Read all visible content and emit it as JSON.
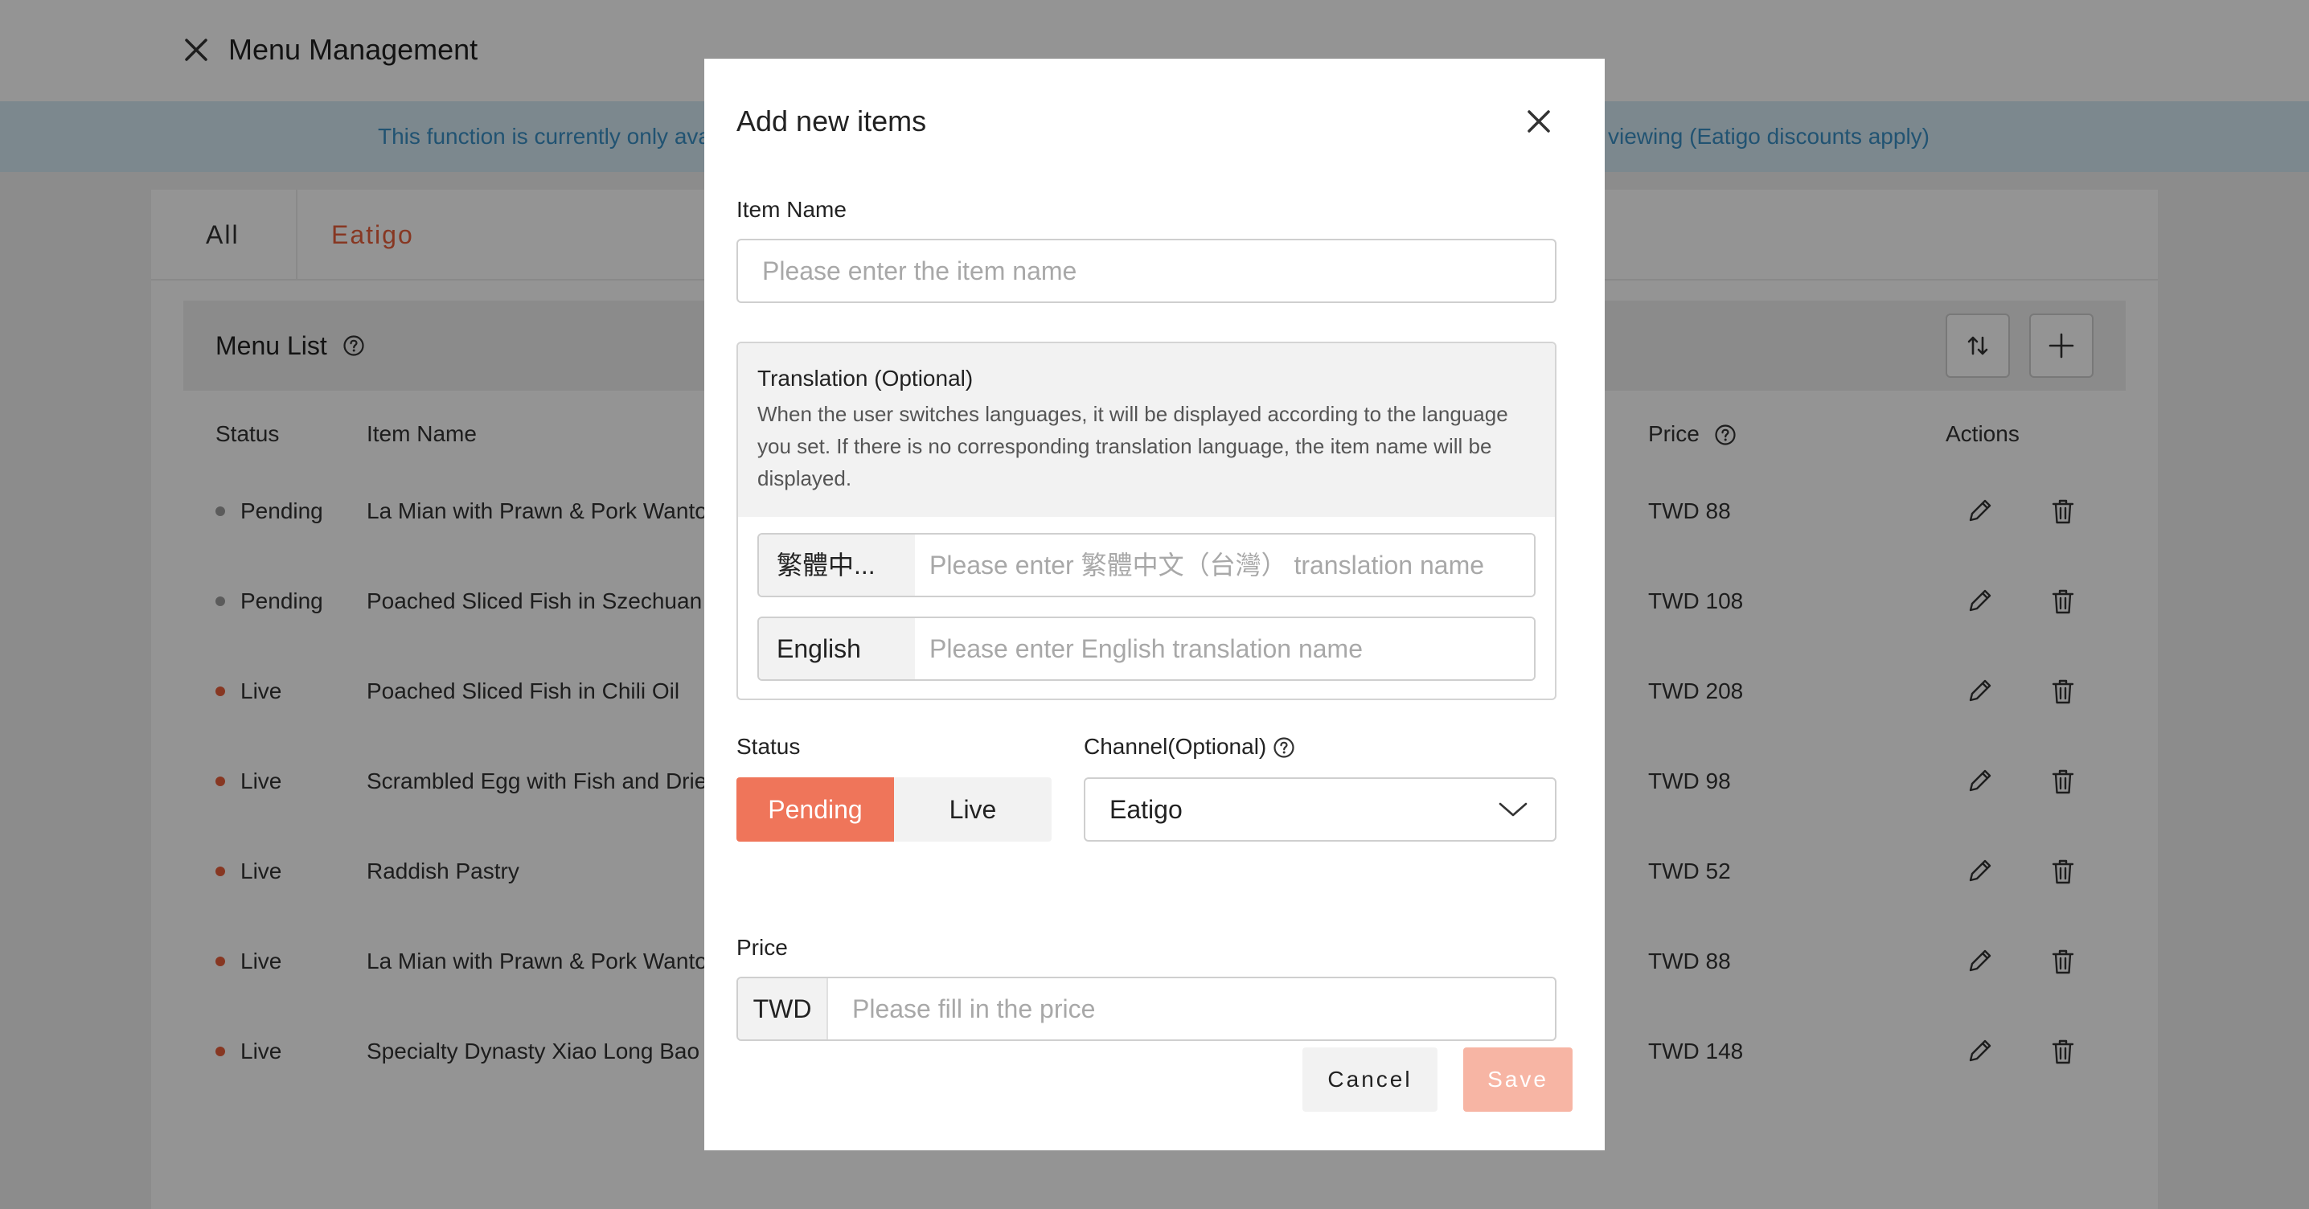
{
  "header": {
    "title": "Menu Management"
  },
  "notice": {
    "left_text": "This function is currently only ava",
    "right_text": "viewing (Eatigo discounts apply)"
  },
  "tabs": [
    {
      "label": "All"
    },
    {
      "label": "Eatigo"
    }
  ],
  "menu_list": {
    "title": "Menu List",
    "columns": {
      "status": "Status",
      "item_name": "Item Name",
      "price": "Price",
      "actions": "Actions"
    },
    "rows": [
      {
        "status": "Pending",
        "name": "La Mian with Prawn & Pork Wanto",
        "price": "TWD 88"
      },
      {
        "status": "Pending",
        "name": "Poached Sliced Fish in Szechuan (",
        "price": "TWD 108"
      },
      {
        "status": "Live",
        "name": "Poached Sliced Fish in Chili Oil",
        "price": "TWD 208"
      },
      {
        "status": "Live",
        "name": "Scrambled Egg with Fish and Driec",
        "price": "TWD 98"
      },
      {
        "status": "Live",
        "name": "Raddish Pastry",
        "price": "TWD 52"
      },
      {
        "status": "Live",
        "name": "La Mian with Prawn & Pork Wanto",
        "price": "TWD 88"
      },
      {
        "status": "Live",
        "name": "Specialty Dynasty Xiao Long Bao (",
        "price": "TWD 148"
      }
    ]
  },
  "modal": {
    "title": "Add new items",
    "item_name_label": "Item Name",
    "item_name_placeholder": "Please enter the item name",
    "translation": {
      "title": "Translation (Optional)",
      "description": "When the user switches languages, it will be displayed according to the language you set. If there is no corresponding translation language, the item name will be displayed.",
      "languages": [
        {
          "tag": "繁體中...",
          "placeholder": "Please enter 繁體中文（台灣） translation name"
        },
        {
          "tag": "English",
          "placeholder": "Please enter English translation name"
        }
      ]
    },
    "status_label": "Status",
    "status_options": [
      "Pending",
      "Live"
    ],
    "status_selected": "Pending",
    "channel_label": "Channel(Optional)",
    "channel_value": "Eatigo",
    "price_label": "Price",
    "price_currency": "TWD",
    "price_placeholder": "Please fill in the price",
    "cancel_label": "Cancel",
    "save_label": "Save"
  },
  "colors": {
    "accent": "#ef755a",
    "accent_disabled": "#f7b5a4",
    "tab_active": "#e8603c",
    "status_live": "#e8603c",
    "status_pending": "#9e9e9e",
    "notice_bg": "#d6eaf5",
    "notice_text": "#3a8fc4"
  },
  "icons": {
    "close": "close-icon",
    "help": "help-icon",
    "sort": "sort-icon",
    "add": "plus-icon",
    "edit": "pencil-icon",
    "delete": "trash-icon",
    "dropdown": "chevron-down-icon"
  }
}
